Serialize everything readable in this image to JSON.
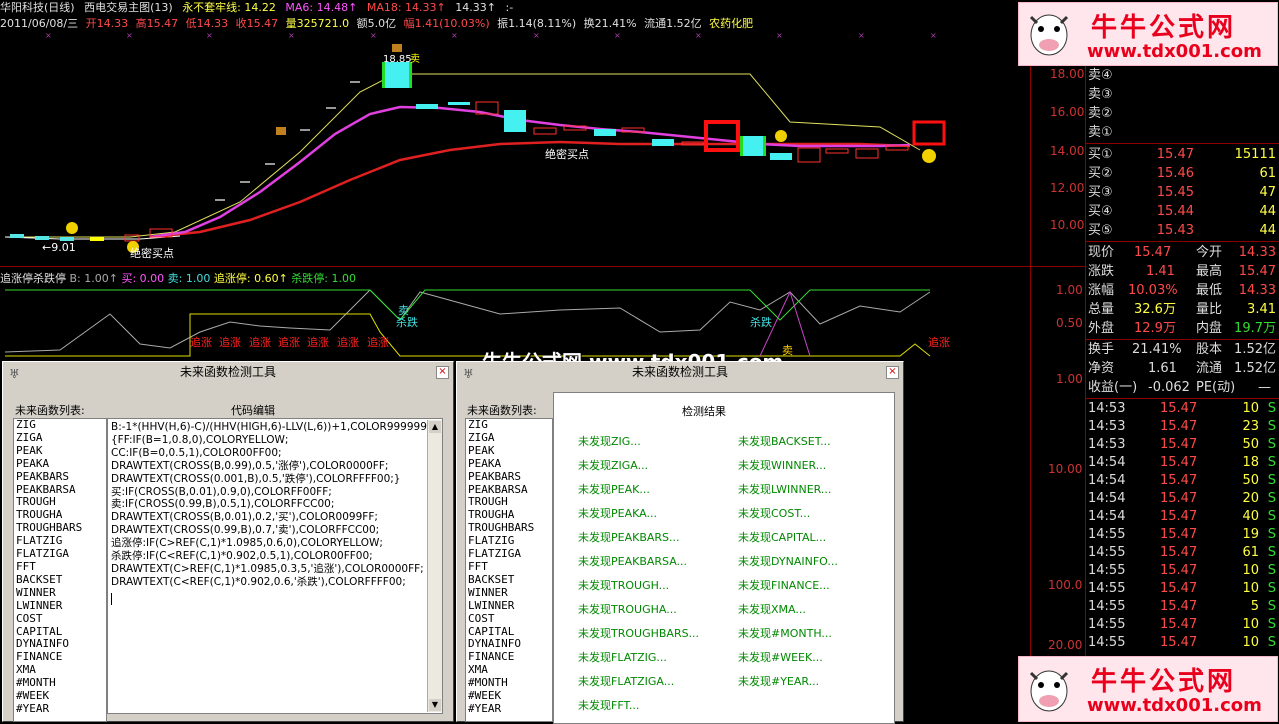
{
  "header": {
    "title": "华阳科技(日线)",
    "subtitle": "西电交易主图(13)",
    "line1_label": "永不套牢线: 14.22",
    "ma6": "MA6: 14.48↑",
    "ma18": "MA18: 14.33↑",
    "line4": "14.33↑",
    "dots": ":-"
  },
  "info": {
    "date": "2011/06/08/三",
    "open": "开14.33",
    "high": "高15.47",
    "low": "低14.33",
    "close": "收15.47",
    "volume": "量325721.0",
    "amount": "额5.0亿",
    "change": "幅1.41(10.03%)",
    "amplitude": "振1.14(8.11%)",
    "turnover": "换21.41%",
    "float": "流通1.52亿",
    "industry": "农药化肥"
  },
  "chart_labels": {
    "juemi1": "绝密买点",
    "juemi2": "绝密买点",
    "price_low": "←9.01",
    "price_high": "18.85",
    "sell_flag": "卖"
  },
  "indicator": {
    "name": "追涨停杀跌停",
    "b": "B: 1.00↑",
    "buy": "买: 0.00",
    "sell": "卖: 1.00",
    "zhui": "追涨停: 0.60↑",
    "sha": "杀跌停: 1.00",
    "label_zhui": "追涨",
    "label_sha": "杀跌",
    "label_mai": "卖"
  },
  "axis": {
    "main": [
      "18.00",
      "16.00",
      "14.00",
      "12.00",
      "10.00"
    ],
    "ind": [
      "1.00",
      "0.50"
    ],
    "lower": [
      "1.00",
      "10.00",
      "100.0",
      "20.00"
    ]
  },
  "quote": {
    "sells": [
      {
        "label": "卖④"
      },
      {
        "label": "卖③"
      },
      {
        "label": "卖②"
      },
      {
        "label": "卖①"
      }
    ],
    "buys": [
      {
        "label": "买①",
        "price": "15.47",
        "vol": "15111"
      },
      {
        "label": "买②",
        "price": "15.46",
        "vol": "61"
      },
      {
        "label": "买③",
        "price": "15.45",
        "vol": "47"
      },
      {
        "label": "买④",
        "price": "15.44",
        "vol": "44"
      },
      {
        "label": "买⑤",
        "price": "15.43",
        "vol": "44"
      }
    ],
    "stats": [
      {
        "l1": "现价",
        "v1": "15.47",
        "l2": "今开",
        "v2": "14.33"
      },
      {
        "l1": "涨跌",
        "v1": "1.41",
        "l2": "最高",
        "v2": "15.47"
      },
      {
        "l1": "涨幅",
        "v1": "10.03%",
        "l2": "最低",
        "v2": "14.33"
      },
      {
        "l1": "总量",
        "v1": "32.6万",
        "l2": "量比",
        "v2": "3.41"
      },
      {
        "l1": "外盘",
        "v1": "12.9万",
        "l2": "内盘",
        "v2": "19.7万"
      }
    ],
    "stats2": [
      {
        "l1": "换手",
        "v1": "21.41%",
        "l2": "股本",
        "v2": "1.52亿"
      },
      {
        "l1": "净资",
        "v1": "1.61",
        "l2": "流通",
        "v2": "1.52亿"
      }
    ],
    "earn": {
      "label": "收益(一)",
      "value": "-0.062",
      "pe": "PE(动)",
      "pe_val": "—"
    }
  },
  "ticks": [
    {
      "t": "14:53",
      "p": "15.47",
      "v": "10",
      "s": "S"
    },
    {
      "t": "14:53",
      "p": "15.47",
      "v": "23",
      "s": "S"
    },
    {
      "t": "14:53",
      "p": "15.47",
      "v": "50",
      "s": "S"
    },
    {
      "t": "14:54",
      "p": "15.47",
      "v": "18",
      "s": "S"
    },
    {
      "t": "14:54",
      "p": "15.47",
      "v": "50",
      "s": "S"
    },
    {
      "t": "14:54",
      "p": "15.47",
      "v": "20",
      "s": "S"
    },
    {
      "t": "14:54",
      "p": "15.47",
      "v": "40",
      "s": "S"
    },
    {
      "t": "14:55",
      "p": "15.47",
      "v": "19",
      "s": "S"
    },
    {
      "t": "14:55",
      "p": "15.47",
      "v": "61",
      "s": "S"
    },
    {
      "t": "14:55",
      "p": "15.47",
      "v": "10",
      "s": "S"
    },
    {
      "t": "14:55",
      "p": "15.47",
      "v": "10",
      "s": "S"
    },
    {
      "t": "14:55",
      "p": "15.47",
      "v": "5",
      "s": "S"
    },
    {
      "t": "14:55",
      "p": "15.47",
      "v": "10",
      "s": "S"
    },
    {
      "t": "14:55",
      "p": "15.47",
      "v": "10",
      "s": "S"
    }
  ],
  "watermark": {
    "name": "牛牛公式网",
    "url": "www.tdx001.com",
    "center": "牛牛公式网 www.tdx001.com"
  },
  "left_window": {
    "title": "未来函数检测工具",
    "list_label": "未来函数列表:",
    "code_label": "代码编辑",
    "functions": [
      "ZIG",
      "ZIGA",
      "PEAK",
      "PEAKA",
      "PEAKBARS",
      "PEAKBARSA",
      "TROUGH",
      "TROUGHA",
      "TROUGHBARS",
      "FLATZIG",
      "FLATZIGA",
      "FFT",
      "BACKSET",
      "WINNER",
      "LWINNER",
      "COST",
      "CAPITAL",
      "DYNAINFO",
      "FINANCE",
      "XMA",
      "#MONTH",
      "#WEEK",
      "#YEAR"
    ],
    "code": [
      "B:-1*(HHV(H,6)-C)/(HHV(HIGH,6)-LLV(L,6))+1,COLOR999999;",
      "{FF:IF(B=1,0.8,0),COLORYELLOW;",
      "CC:IF(B=0,0.5,1),COLOR00FF00;",
      "DRAWTEXT(CROSS(B,0.99),0.5,'涨停'),COLOR0000FF;",
      "DRAWTEXT(CROSS(0.001,B),0.5,'跌停'),COLORFFFF00;}",
      "买:IF(CROSS(B,0.01),0.9,0),COLORFF00FF;",
      "卖:IF(CROSS(0.99,B),0.5,1),COLORFFCC00;",
      "DRAWTEXT(CROSS(B,0.01),0.2,'买'),COLOR0099FF;",
      "DRAWTEXT(CROSS(0.99,B),0.7,'卖'),COLORFFCC00;",
      "追涨停:IF(C>REF(C,1)*1.0985,0.6,0),COLORYELLOW;",
      "杀跌停:IF(C<REF(C,1)*0.902,0.5,1),COLOR00FF00;",
      "DRAWTEXT(C>REF(C,1)*1.0985,0.3,5,'追涨'),COLOR0000FF;",
      "DRAWTEXT(C<REF(C,1)*0.902,0.6,'杀跌'),COLORFFFF00;"
    ]
  },
  "right_window": {
    "title": "未来函数检测工具",
    "list_label": "未来函数列表:",
    "result_label": "检测结果",
    "functions": [
      "ZIG",
      "ZIGA",
      "PEAK",
      "PEAKA",
      "PEAKBARS",
      "PEAKBARSA",
      "TROUGH",
      "TROUGHA",
      "TROUGHBARS",
      "FLATZIG",
      "FLATZIGA",
      "FFT",
      "BACKSET",
      "WINNER",
      "LWINNER",
      "COST",
      "CAPITAL",
      "DYNAINFO",
      "FINANCE",
      "XMA",
      "#MONTH",
      "#WEEK",
      "#YEAR"
    ],
    "results_col1": [
      "未发现ZIG...",
      "未发现ZIGA...",
      "未发现PEAK...",
      "未发现PEAKA...",
      "未发现PEAKBARS...",
      "未发现PEAKBARSA...",
      "未发现TROUGH...",
      "未发现TROUGHA...",
      "未发现TROUGHBARS...",
      "未发现FLATZIG...",
      "未发现FLATZIGA...",
      "未发现FFT..."
    ],
    "results_col2": [
      "未发现BACKSET...",
      "未发现WINNER...",
      "未发现LWINNER...",
      "未发现COST...",
      "未发现CAPITAL...",
      "未发现DYNAINFO...",
      "未发现FINANCE...",
      "未发现XMA...",
      "未发现#MONTH...",
      "未发现#WEEK...",
      "未发现#YEAR..."
    ]
  }
}
